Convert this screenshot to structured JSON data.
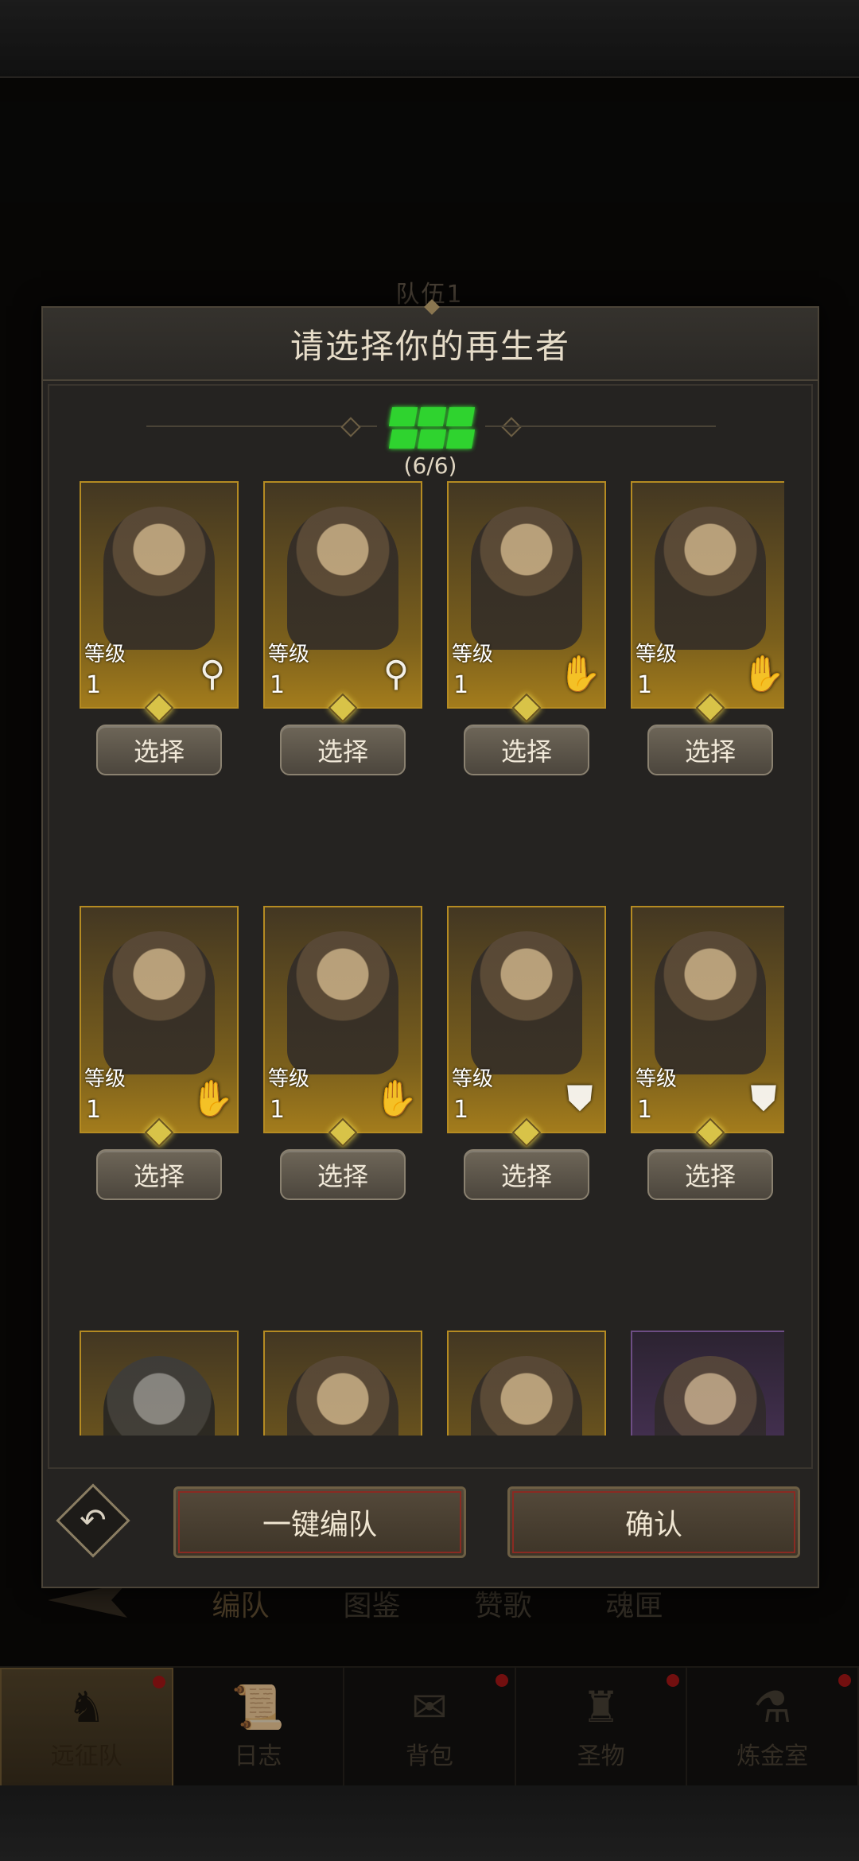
{
  "background": {
    "team_title": "队伍1",
    "tabs": [
      "编队",
      "图鉴",
      "赞歌",
      "魂匣"
    ],
    "active_tab": 0
  },
  "bottom_nav": [
    {
      "label": "远征队",
      "icon": "helmet-icon",
      "active": true,
      "dot": true
    },
    {
      "label": "日志",
      "icon": "scroll-icon",
      "active": false,
      "dot": false
    },
    {
      "label": "背包",
      "icon": "bag-icon",
      "active": false,
      "dot": true
    },
    {
      "label": "圣物",
      "icon": "chalice-icon",
      "active": false,
      "dot": true
    },
    {
      "label": "炼金室",
      "icon": "alchemy-icon",
      "active": false,
      "dot": true
    }
  ],
  "modal": {
    "title": "请选择你的再生者",
    "slot_count": "(6/6)",
    "slots_filled": 6,
    "slots_total": 6,
    "level_label": "等级",
    "select_label": "选择",
    "auto_team_label": "一键编队",
    "confirm_label": "确认"
  },
  "heroes": [
    {
      "level": "1",
      "class": "staff-icon"
    },
    {
      "level": "1",
      "class": "staff-icon"
    },
    {
      "level": "1",
      "class": "hand-icon"
    },
    {
      "level": "1",
      "class": "hand-icon"
    },
    {
      "level": "1",
      "class": "hand-icon"
    },
    {
      "level": "1",
      "class": "hand-icon"
    },
    {
      "level": "1",
      "class": "shield-icon"
    },
    {
      "level": "1",
      "class": "shield-icon"
    }
  ],
  "colors": {
    "slot_green": "#2fd32f",
    "card_gold": "#b58b22",
    "alert_red": "#b01818"
  }
}
